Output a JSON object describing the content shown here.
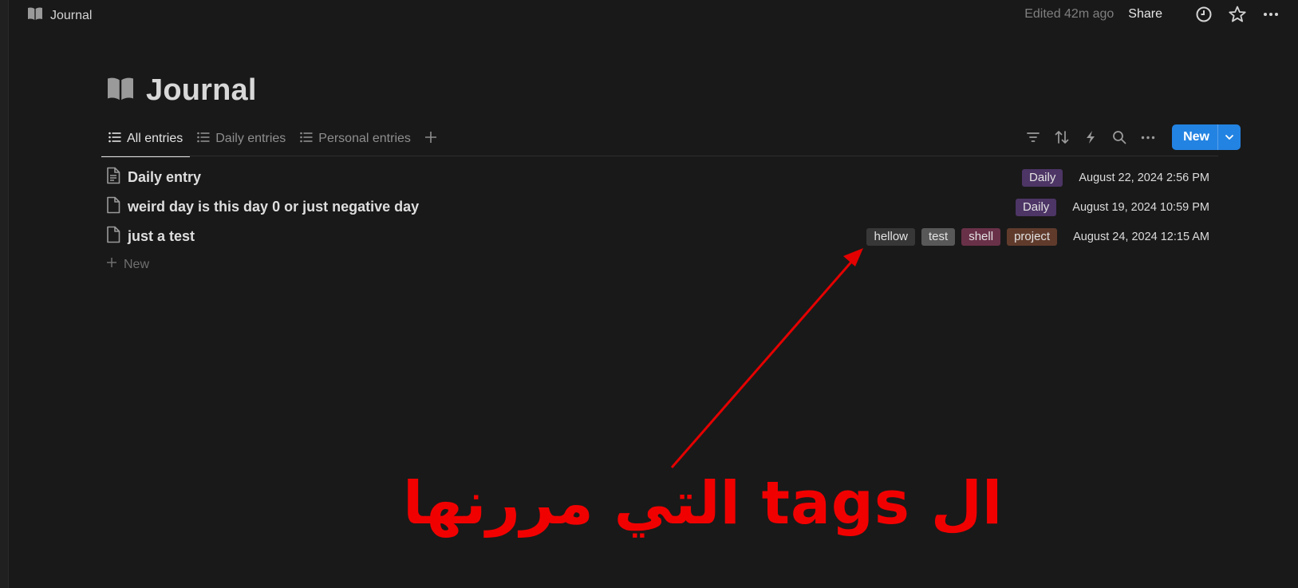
{
  "topbar": {
    "breadcrumb": "Journal",
    "edited": "Edited 42m ago",
    "share": "Share"
  },
  "page": {
    "title": "Journal"
  },
  "tabs": [
    {
      "label": "All entries"
    },
    {
      "label": "Daily entries"
    },
    {
      "label": "Personal entries"
    }
  ],
  "toolbar": {
    "new_label": "New"
  },
  "rows": [
    {
      "name": "Daily entry",
      "tags": [
        {
          "label": "Daily",
          "color": "#4d3566"
        }
      ],
      "date": "August 22, 2024 2:56 PM"
    },
    {
      "name": "weird day is this day 0 or just negative day",
      "tags": [
        {
          "label": "Daily",
          "color": "#4d3566"
        }
      ],
      "date": "August 19, 2024 10:59 PM"
    },
    {
      "name": "just a test",
      "tags": [
        {
          "label": "hellow",
          "color": "#373737"
        },
        {
          "label": "test",
          "color": "#585858"
        },
        {
          "label": "shell",
          "color": "#693148"
        },
        {
          "label": "project",
          "color": "#603b2c"
        }
      ],
      "date": "August 24, 2024 12:15 AM"
    }
  ],
  "new_row": "New",
  "annotation": {
    "text": "ال tags التي مررنها",
    "color": "#f10000"
  },
  "colors": {
    "accent": "#2383e2",
    "background": "#191919"
  }
}
